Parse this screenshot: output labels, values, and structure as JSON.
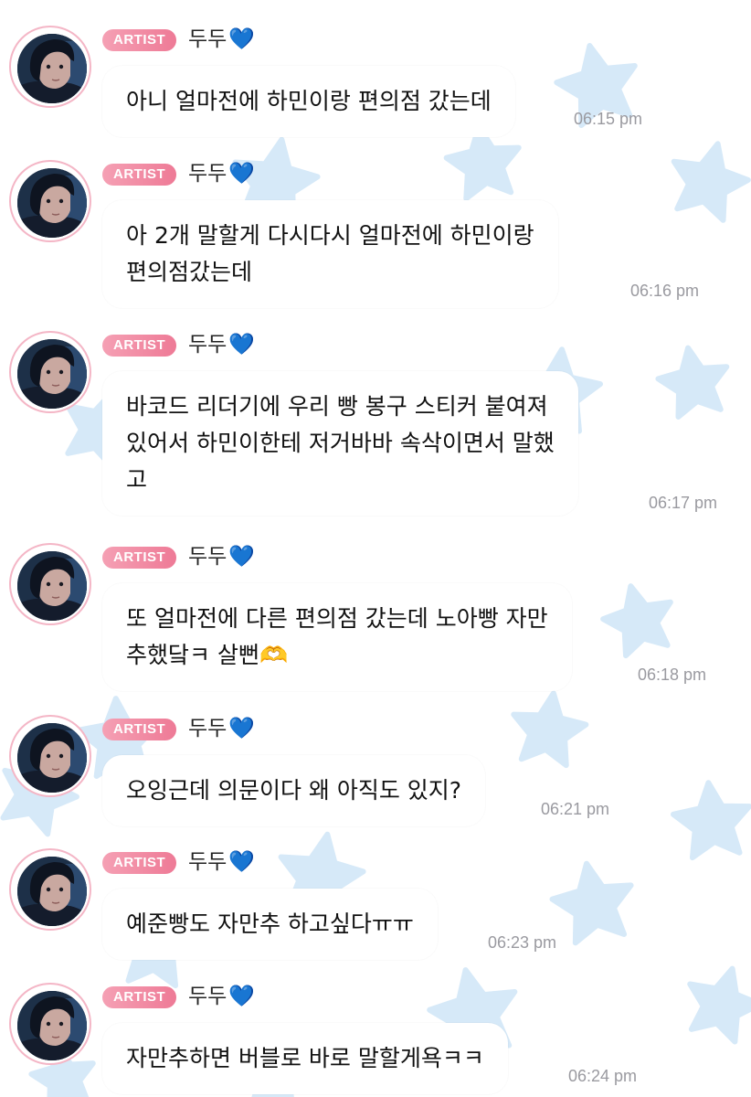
{
  "colors": {
    "badge": "#ee7a96",
    "heart": "#1e6ff0",
    "star": "#d6e9f8",
    "timestamp": "#9a9aa0"
  },
  "messages": [
    {
      "badge": "ARTIST",
      "sender": "두두",
      "heart": "💙",
      "lines": [
        "아니 얼마전에 하민이랑 편의점 갔는데"
      ],
      "time": "06:15 pm"
    },
    {
      "badge": "ARTIST",
      "sender": "두두",
      "heart": "💙",
      "lines": [
        "아 2개 말할게 다시다시 얼마전에 하민이랑",
        "편의점갔는데"
      ],
      "time": "06:16 pm"
    },
    {
      "badge": "ARTIST",
      "sender": "두두",
      "heart": "💙",
      "lines": [
        "바코드 리더기에 우리 빵 봉구 스티커 붙여져",
        "있어서 하민이한테 저거바바 속삭이면서 말했",
        "고"
      ],
      "time": "06:17 pm"
    },
    {
      "badge": "ARTIST",
      "sender": "두두",
      "heart": "💙",
      "lines": [
        "또 얼마전에 다른 편의점 갔는데 노아빵 자만",
        "추했닼ㅋ 살뻔🫶"
      ],
      "time": "06:18 pm"
    },
    {
      "badge": "ARTIST",
      "sender": "두두",
      "heart": "💙",
      "lines": [
        "오잉근데 의문이다 왜 아직도 있지?"
      ],
      "time": "06:21 pm"
    },
    {
      "badge": "ARTIST",
      "sender": "두두",
      "heart": "💙",
      "lines": [
        "예준빵도 자만추 하고싶다ㅠㅠ"
      ],
      "time": "06:23 pm"
    },
    {
      "badge": "ARTIST",
      "sender": "두두",
      "heart": "💙",
      "lines": [
        "자만추하면 버블로 바로 말할게욕ㅋㅋ"
      ],
      "time": "06:24 pm"
    }
  ]
}
